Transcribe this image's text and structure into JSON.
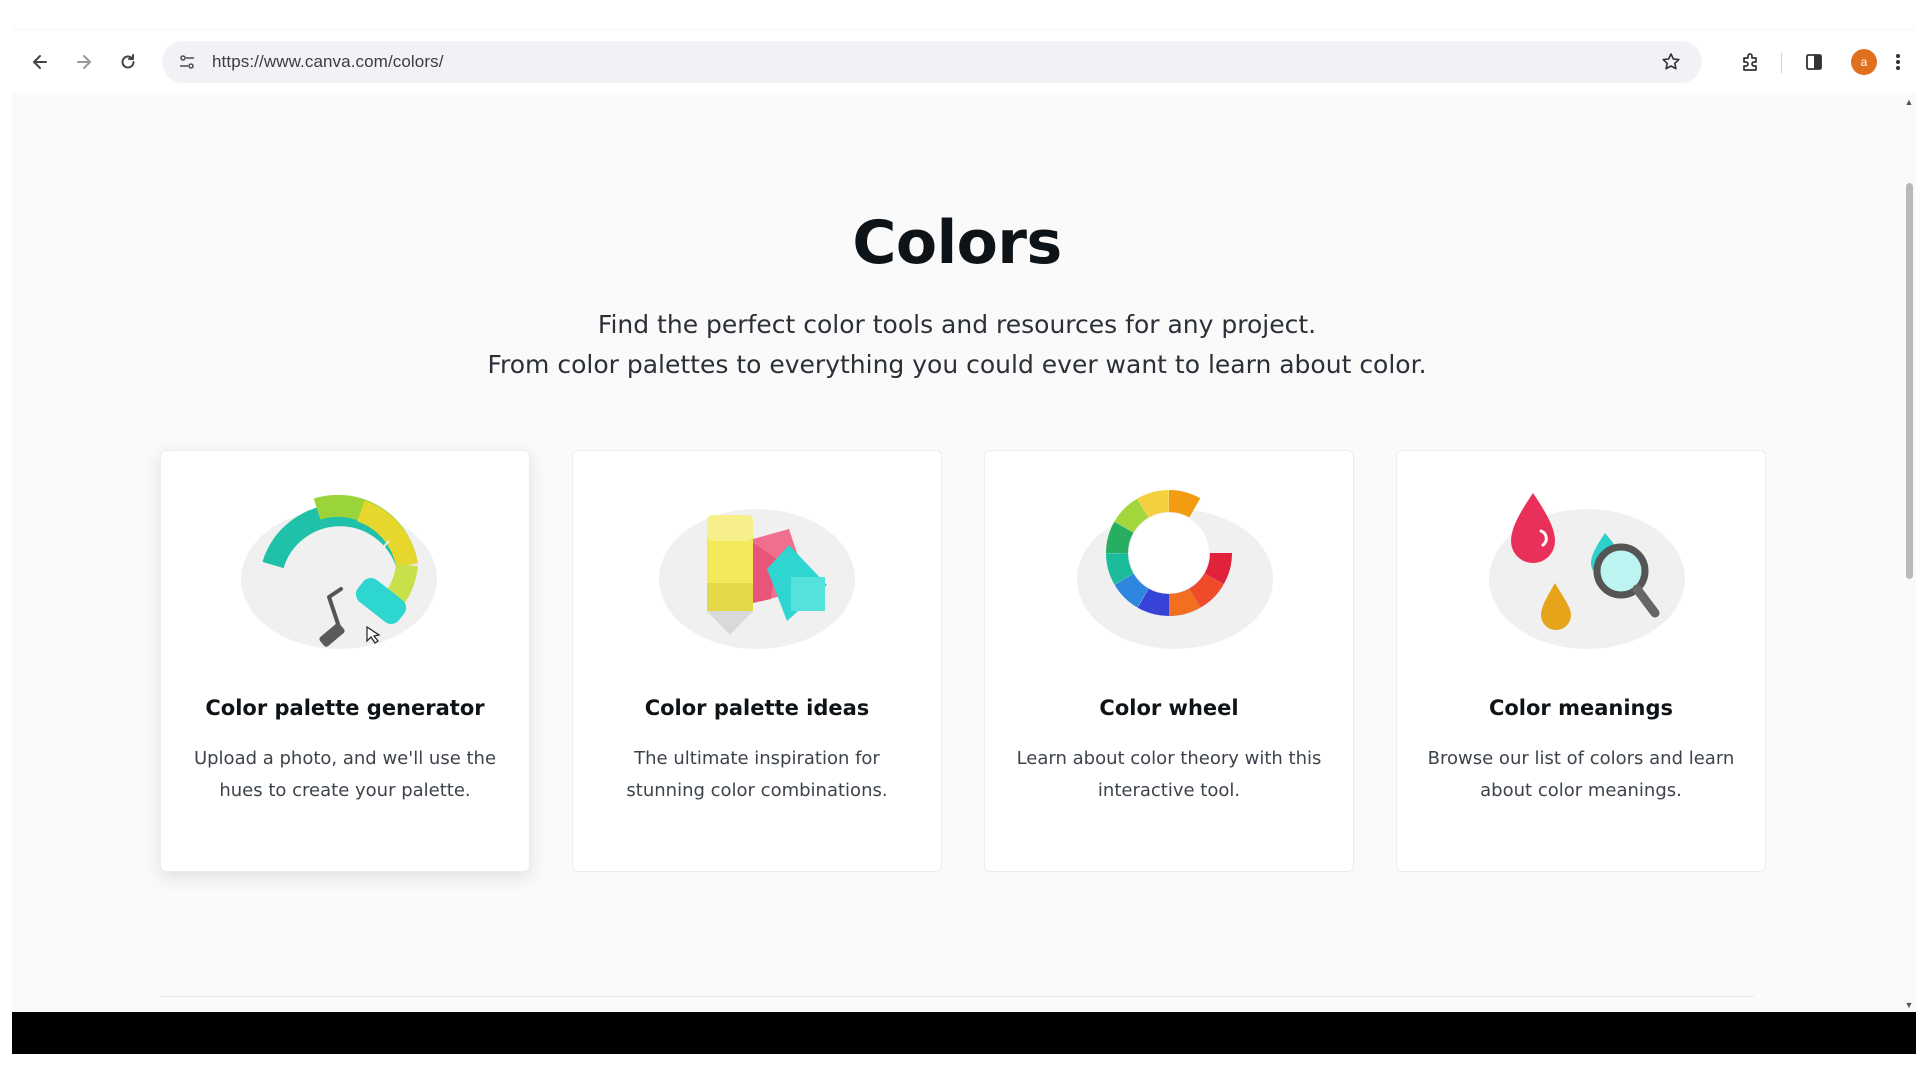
{
  "browser": {
    "url": "https://www.canva.com/colors/",
    "avatar_initial": "a",
    "icons": [
      "back-icon",
      "forward-icon",
      "reload-icon",
      "site-info-icon",
      "star-icon",
      "extensions-icon",
      "side-panel-icon",
      "menu-icon"
    ]
  },
  "page": {
    "title": "Colors",
    "subtitle_line1": "Find the perfect color tools and resources for any project.",
    "subtitle_line2": "From color palettes to everything you could ever want to learn about color.",
    "cards": [
      {
        "title": "Color palette generator",
        "description": "Upload a photo, and we'll use the hues to create your palette.",
        "icon": "paint-roller-icon"
      },
      {
        "title": "Color palette ideas",
        "description": "The ultimate inspiration for stunning color combinations.",
        "icon": "swatch-book-icon"
      },
      {
        "title": "Color wheel",
        "description": "Learn about color theory with this interactive tool.",
        "icon": "color-wheel-icon"
      },
      {
        "title": "Color meanings",
        "description": "Browse our list of colors and learn about color meanings.",
        "icon": "drops-magnifier-icon"
      }
    ]
  },
  "colors": {
    "accent_avatar": "#e0701e",
    "text_primary": "#0e1318"
  }
}
